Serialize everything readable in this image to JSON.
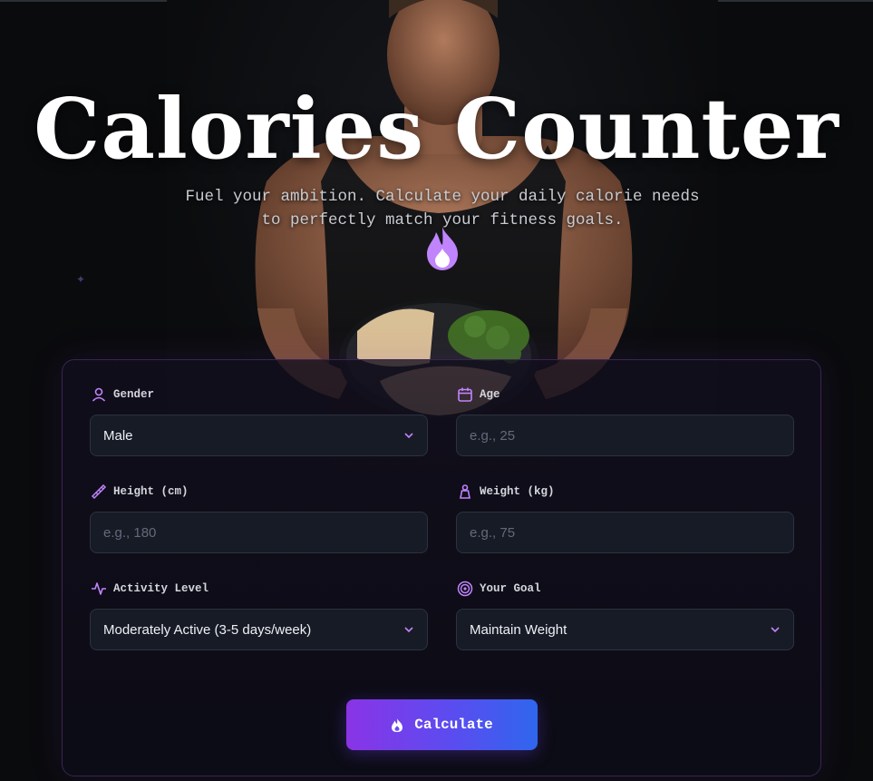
{
  "header": {
    "title": "Calories Counter",
    "subtitle_line1": "Fuel your ambition. Calculate your daily calorie needs",
    "subtitle_line2": "to perfectly match your fitness goals."
  },
  "form": {
    "gender": {
      "label": "Gender",
      "value": "Male",
      "icon": "user-icon"
    },
    "age": {
      "label": "Age",
      "placeholder": "e.g., 25",
      "icon": "calendar-icon"
    },
    "height": {
      "label": "Height (cm)",
      "placeholder": "e.g., 180",
      "icon": "ruler-icon"
    },
    "weight": {
      "label": "Weight (kg)",
      "placeholder": "e.g., 75",
      "icon": "weight-icon"
    },
    "activity": {
      "label": "Activity Level",
      "value": "Moderately Active (3-5 days/week)",
      "icon": "activity-icon"
    },
    "goal": {
      "label": "Your Goal",
      "value": "Maintain Weight",
      "icon": "target-icon"
    }
  },
  "actions": {
    "calculate_label": "Calculate",
    "icon": "flame-icon"
  },
  "colors": {
    "accent": "#c084fc",
    "button_start": "#8a34e6",
    "button_end": "#2f66ee",
    "background": "#0a0b0d"
  }
}
